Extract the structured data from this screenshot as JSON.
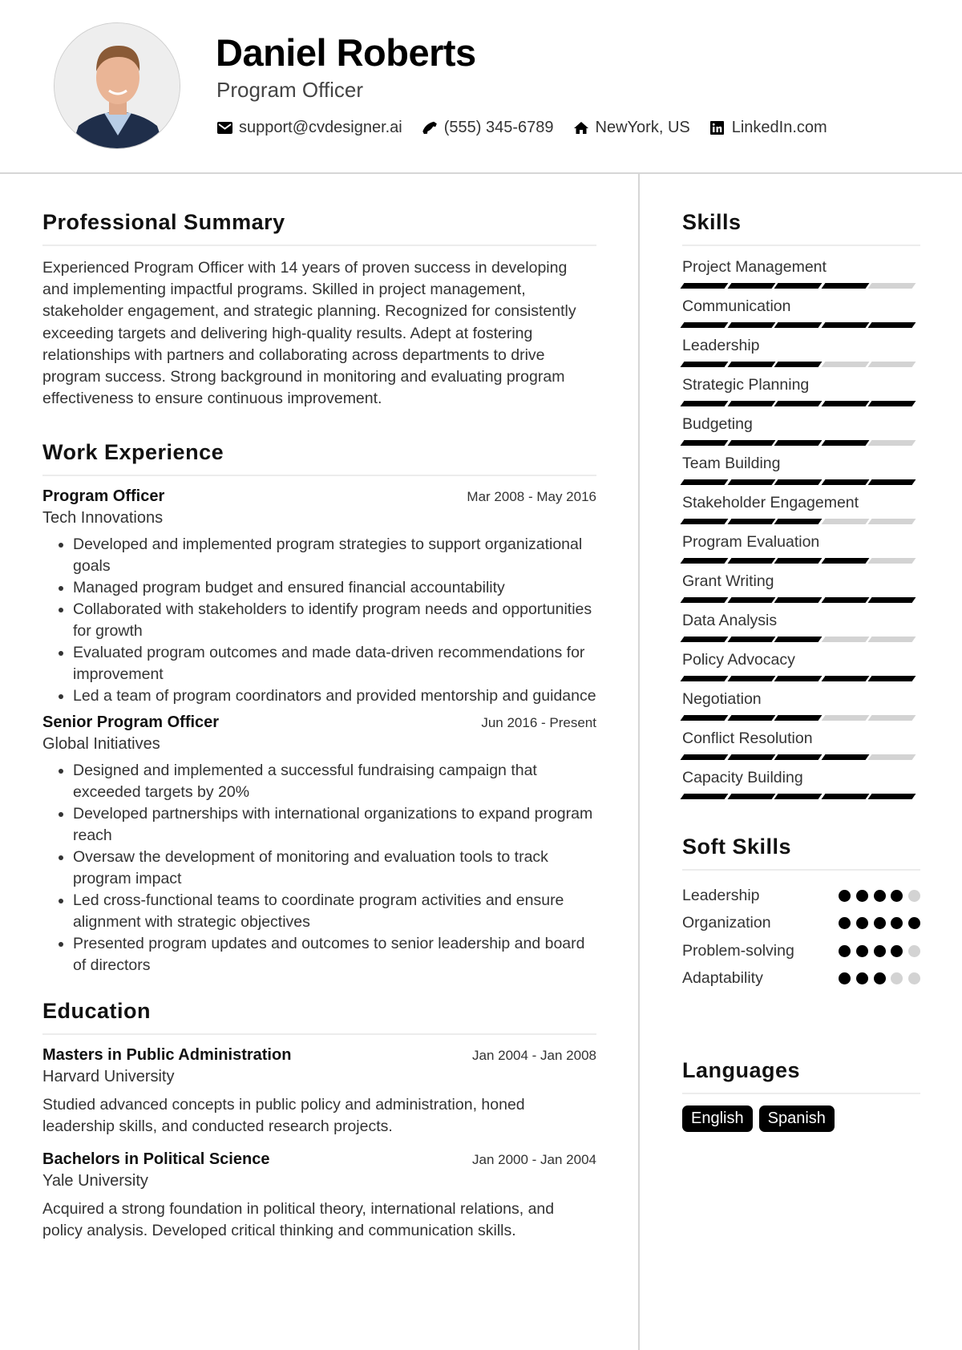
{
  "header": {
    "name": "Daniel Roberts",
    "title": "Program Officer",
    "contacts": [
      {
        "icon": "envelope-icon",
        "text": "support@cvdesigner.ai"
      },
      {
        "icon": "phone-icon",
        "text": "(555) 345-6789"
      },
      {
        "icon": "home-icon",
        "text": "NewYork, US"
      },
      {
        "icon": "linkedin-icon",
        "text": "LinkedIn.com"
      }
    ]
  },
  "summary": {
    "heading": "Professional Summary",
    "text": "Experienced Program Officer with 14 years of proven success in developing and implementing impactful programs. Skilled in project management, stakeholder engagement, and strategic planning. Recognized for consistently exceeding targets and delivering high-quality results. Adept at fostering relationships with partners and collaborating across departments to drive program success. Strong background in monitoring and evaluating program effectiveness to ensure continuous improvement."
  },
  "experience": {
    "heading": "Work Experience",
    "jobs": [
      {
        "title": "Program Officer",
        "dates": "Mar 2008 - May 2016",
        "company": "Tech Innovations",
        "bullets": [
          "Developed and implemented program strategies to support organizational goals",
          "Managed program budget and ensured financial accountability",
          "Collaborated with stakeholders to identify program needs and opportunities for growth",
          "Evaluated program outcomes and made data-driven recommendations for improvement",
          "Led a team of program coordinators and provided mentorship and guidance"
        ]
      },
      {
        "title": "Senior Program Officer",
        "dates": "Jun 2016 - Present",
        "company": "Global Initiatives",
        "bullets": [
          "Designed and implemented a successful fundraising campaign that exceeded targets by 20%",
          "Developed partnerships with international organizations to expand program reach",
          "Oversaw the development of monitoring and evaluation tools to track program impact",
          "Led cross-functional teams to coordinate program activities and ensure alignment with strategic objectives",
          "Presented program updates and outcomes to senior leadership and board of directors"
        ]
      }
    ]
  },
  "education": {
    "heading": "Education",
    "items": [
      {
        "degree": "Masters in Public Administration",
        "dates": "Jan 2004 - Jan 2008",
        "school": "Harvard University",
        "description": "Studied advanced concepts in public policy and administration, honed leadership skills, and conducted research projects."
      },
      {
        "degree": "Bachelors in Political Science",
        "dates": "Jan 2000 - Jan 2004",
        "school": "Yale University",
        "description": "Acquired a strong foundation in political theory, international relations, and policy analysis. Developed critical thinking and communication skills."
      }
    ]
  },
  "skills": {
    "heading": "Skills",
    "max_level": 5,
    "items": [
      {
        "name": "Project Management",
        "level": 4
      },
      {
        "name": "Communication",
        "level": 5
      },
      {
        "name": "Leadership",
        "level": 3
      },
      {
        "name": "Strategic Planning",
        "level": 5
      },
      {
        "name": "Budgeting",
        "level": 4
      },
      {
        "name": "Team Building",
        "level": 5
      },
      {
        "name": "Stakeholder Engagement",
        "level": 3
      },
      {
        "name": "Program Evaluation",
        "level": 4
      },
      {
        "name": "Grant Writing",
        "level": 5
      },
      {
        "name": "Data Analysis",
        "level": 3
      },
      {
        "name": "Policy Advocacy",
        "level": 5
      },
      {
        "name": "Negotiation",
        "level": 3
      },
      {
        "name": "Conflict Resolution",
        "level": 4
      },
      {
        "name": "Capacity Building",
        "level": 5
      }
    ]
  },
  "soft_skills": {
    "heading": "Soft Skills",
    "max_level": 5,
    "items": [
      {
        "name": "Leadership",
        "level": 4
      },
      {
        "name": "Organization",
        "level": 5
      },
      {
        "name": "Problem-solving",
        "level": 4
      },
      {
        "name": "Adaptability",
        "level": 3
      }
    ]
  },
  "languages": {
    "heading": "Languages",
    "items": [
      "English",
      "Spanish"
    ]
  }
}
